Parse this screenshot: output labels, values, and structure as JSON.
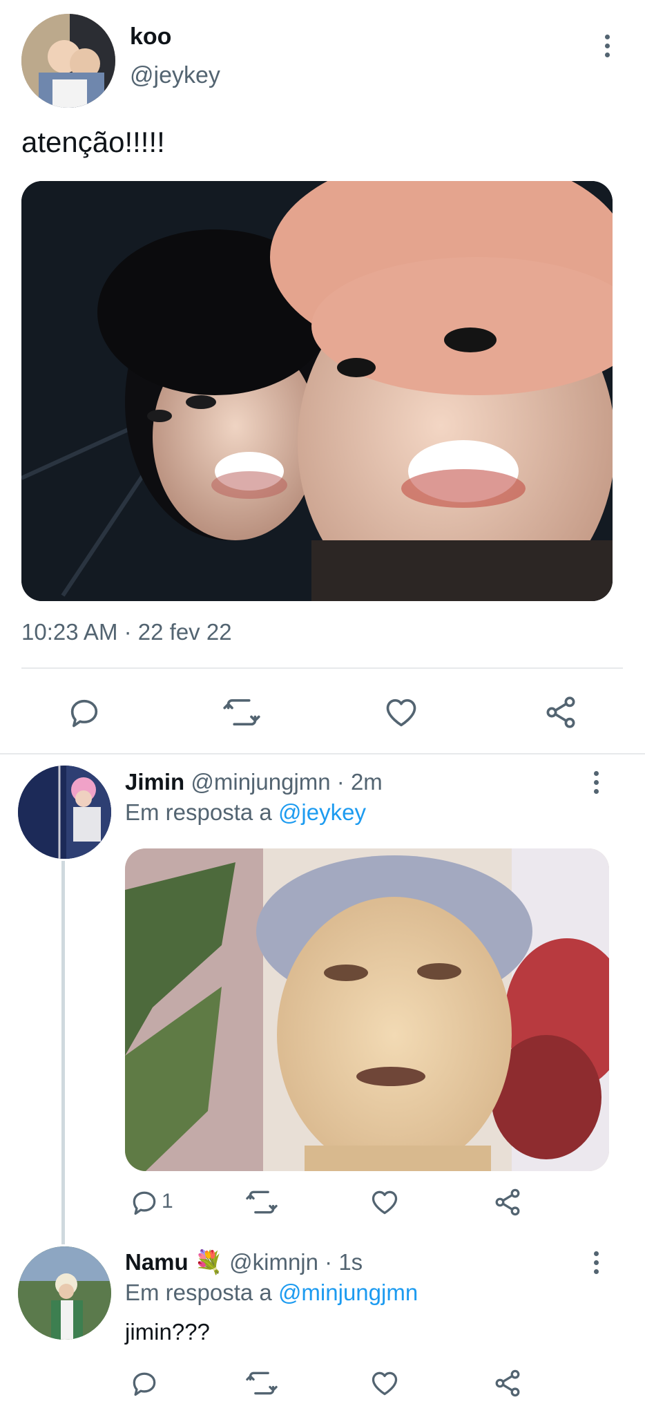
{
  "main_tweet": {
    "display_name": "koo",
    "handle": "@jeykey",
    "text": "atenção!!!!!",
    "time": "10:23 AM",
    "date": "22 fev 22",
    "image_alt": "Selfie photo"
  },
  "replies": [
    {
      "display_name": "Jimin",
      "handle": "@minjungjmn",
      "time": "· 2m",
      "reply_prefix": "Em resposta a",
      "reply_to": "@jeykey",
      "reply_count": "1"
    },
    {
      "display_name": "Namu",
      "emoji": "💐",
      "handle": "@kimnjn",
      "time": "· 1s",
      "reply_prefix": "Em resposta a",
      "reply_to": "@minjungjmn",
      "text": "jimin???"
    }
  ],
  "icons": {
    "reply": "reply-icon",
    "retweet": "retweet-icon",
    "like": "heart-icon",
    "share": "share-icon",
    "more": "more-icon"
  },
  "colors": {
    "accent": "#1d9bf0",
    "muted": "#536471",
    "divider": "#e7e9eb"
  }
}
